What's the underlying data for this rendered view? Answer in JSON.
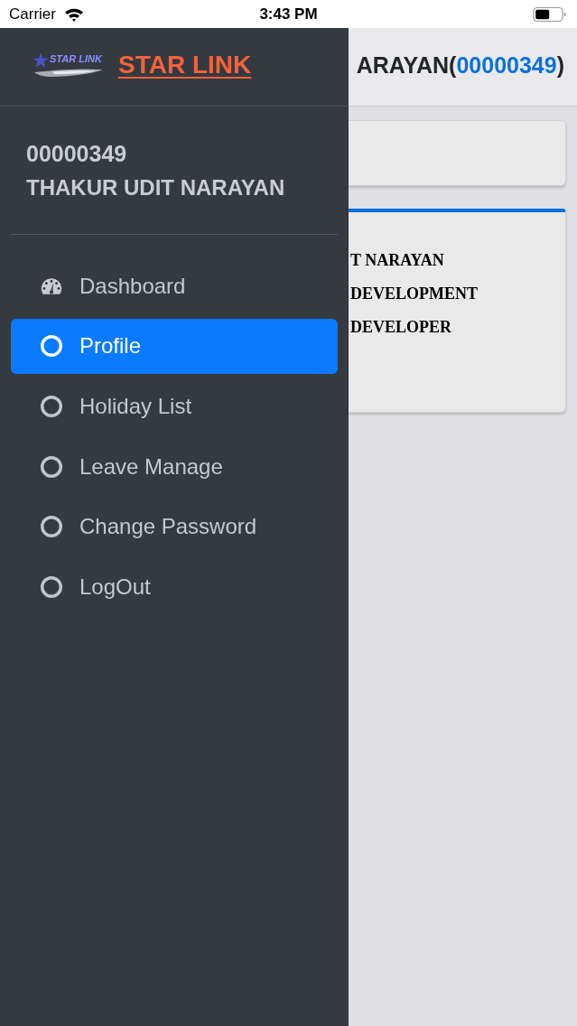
{
  "status_bar": {
    "carrier": "Carrier",
    "time": "3:43 PM"
  },
  "drawer": {
    "logo_text": "STAR LINK",
    "brand": "STAR LINK",
    "user": {
      "id": "00000349",
      "name": "THAKUR UDIT NARAYAN"
    },
    "menu": [
      {
        "label": "Dashboard",
        "kind": "dashboard",
        "selected": false
      },
      {
        "label": "Profile",
        "kind": "circle",
        "selected": true
      },
      {
        "label": "Holiday List",
        "kind": "circle",
        "selected": false
      },
      {
        "label": "Leave Manage",
        "kind": "circle",
        "selected": false
      },
      {
        "label": "Change Password",
        "kind": "circle",
        "selected": false
      },
      {
        "label": "LogOut",
        "kind": "circle",
        "selected": false
      }
    ]
  },
  "page": {
    "header": {
      "name_part": "ARAYAN(",
      "id": "00000349",
      "closing": ")"
    },
    "profile_card": {
      "lines": [
        "T NARAYAN",
        "DEVELOPMENT",
        "DEVELOPER"
      ]
    }
  }
}
